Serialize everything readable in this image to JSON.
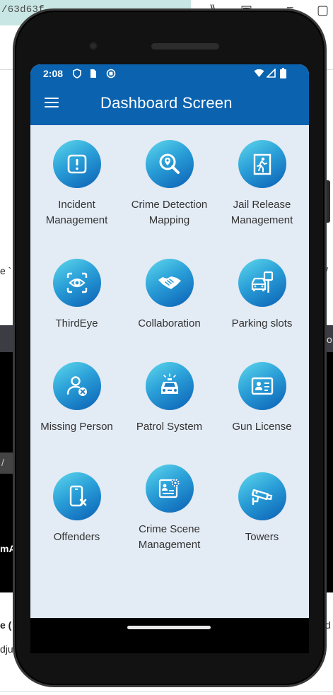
{
  "background": {
    "url_fragment": "/63d63f",
    "left_fragment_1": "e `",
    "left_fragment_2": "/",
    "left_fragment_3": "mA",
    "bottom_fragment_1": "e (",
    "bottom_fragment_2": "dju",
    "right_fragment_1": "/",
    "right_fragment_2": "d",
    "right_fragment_3": "o"
  },
  "status_bar": {
    "time": "2:08",
    "icons": [
      "shield-icon",
      "sim-card-icon",
      "sync-icon",
      "wifi-icon",
      "signal-icon",
      "battery-icon"
    ]
  },
  "app_bar": {
    "title": "Dashboard Screen",
    "menu_icon": "menu-icon"
  },
  "accent_colors": {
    "app_bar": "#0b63b0",
    "screen_bg": "#e3ebf4",
    "icon_gradient": [
      "#5fd8ec",
      "#2a9fd8",
      "#0a5fb4"
    ]
  },
  "tiles": [
    {
      "label": "Incident Management",
      "icon": "alert-icon"
    },
    {
      "label": "Crime Detection Mapping",
      "icon": "search-location-icon"
    },
    {
      "label": "Jail Release Management",
      "icon": "exit-door-icon"
    },
    {
      "label": "ThirdEye",
      "icon": "eye-scan-icon"
    },
    {
      "label": "Collaboration",
      "icon": "handshake-icon"
    },
    {
      "label": "Parking slots",
      "icon": "parking-icon"
    },
    {
      "label": "Missing Person",
      "icon": "missing-person-icon"
    },
    {
      "label": "Patrol System",
      "icon": "police-car-icon"
    },
    {
      "label": "Gun License",
      "icon": "id-card-icon"
    },
    {
      "label": "Offenders",
      "icon": "phone-cancel-icon"
    },
    {
      "label": "Crime Scene Management",
      "icon": "settings-id-icon"
    },
    {
      "label": "Towers",
      "icon": "cctv-camera-icon"
    }
  ]
}
